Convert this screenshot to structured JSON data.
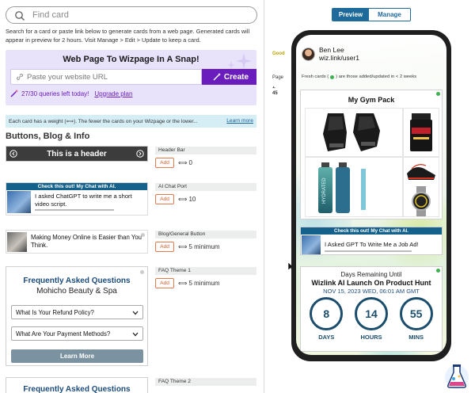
{
  "search": {
    "placeholder": "Find card"
  },
  "intro": "Search for a card or paste link below to generate cards from a web page. Generated cards will appear in preview for 2 hours. Visit Manage > Edit > Update to keep a card.",
  "wizpage": {
    "title": "Web Page To Wizpage In A Snap!",
    "url_placeholder": "Paste your website URL",
    "create_label": "Create",
    "quota": "27/30 queries left today!",
    "upgrade": "Upgrade plan"
  },
  "weight_note": {
    "text": "Each card has a weight (⟺). The fewer the cards on your Wizpage or the lower...",
    "more": "Learn more"
  },
  "section_title": "Buttons, Blog & Info",
  "cards": {
    "header_bar": {
      "text": "This is a header",
      "label": "Header Bar",
      "weight": "0"
    },
    "chat_port": {
      "banner": "Check this out! My Chat with AI.",
      "text": "I asked ChatGPT to write me a short video script.",
      "label": "AI Chat Port",
      "weight": "10"
    },
    "blog": {
      "text": "Making Money Online is Easier than You Think.",
      "label": "Blog/General Button",
      "weight": "5 minimum"
    },
    "faq1": {
      "title": "Frequently Asked Questions",
      "subtitle": "Mohicho Beauty & Spa",
      "q1": "What Is Your Refund Policy?",
      "q2": "What Are Your Payment Methods?",
      "learn": "Learn More",
      "label": "FAQ Theme 1",
      "weight": "5 minimum"
    },
    "faq2": {
      "title": "Frequently Asked Questions",
      "label": "FAQ Theme 2"
    },
    "add_label": "Add"
  },
  "toggle": {
    "preview": "Preview",
    "manage": "Manage"
  },
  "behind": {
    "line1": "Good",
    "line2": "Page",
    "line3": "45"
  },
  "phone": {
    "name": "Ben Lee",
    "handle": "wiz.link/user1",
    "fresh_pre": "Fresh cards (",
    "fresh_post": ") are those added/updated in < 2 weeks",
    "gym_title": "My Gym Pack",
    "bottle_text": "HYDRATED",
    "chat_banner": "Check this out! My Chat with AI.",
    "chat_text": "I Asked GPT To Write Me a Job Ad!",
    "countdown": {
      "line1": "Days Remaining Until",
      "line2": "Wizlink AI Launch On Product Hunt",
      "line3": "NOV 15, 2023 WED, 06:01 AM GMT",
      "days": "8",
      "hours": "14",
      "mins": "55",
      "days_lbl": "DAYS",
      "hours_lbl": "HOURS",
      "mins_lbl": "MINS"
    }
  },
  "colors": {
    "accent_purple": "#6a1cbd",
    "accent_blue": "#1d6a9b",
    "fresh_green": "#3fb24f",
    "chat_banner": "#14628c"
  }
}
